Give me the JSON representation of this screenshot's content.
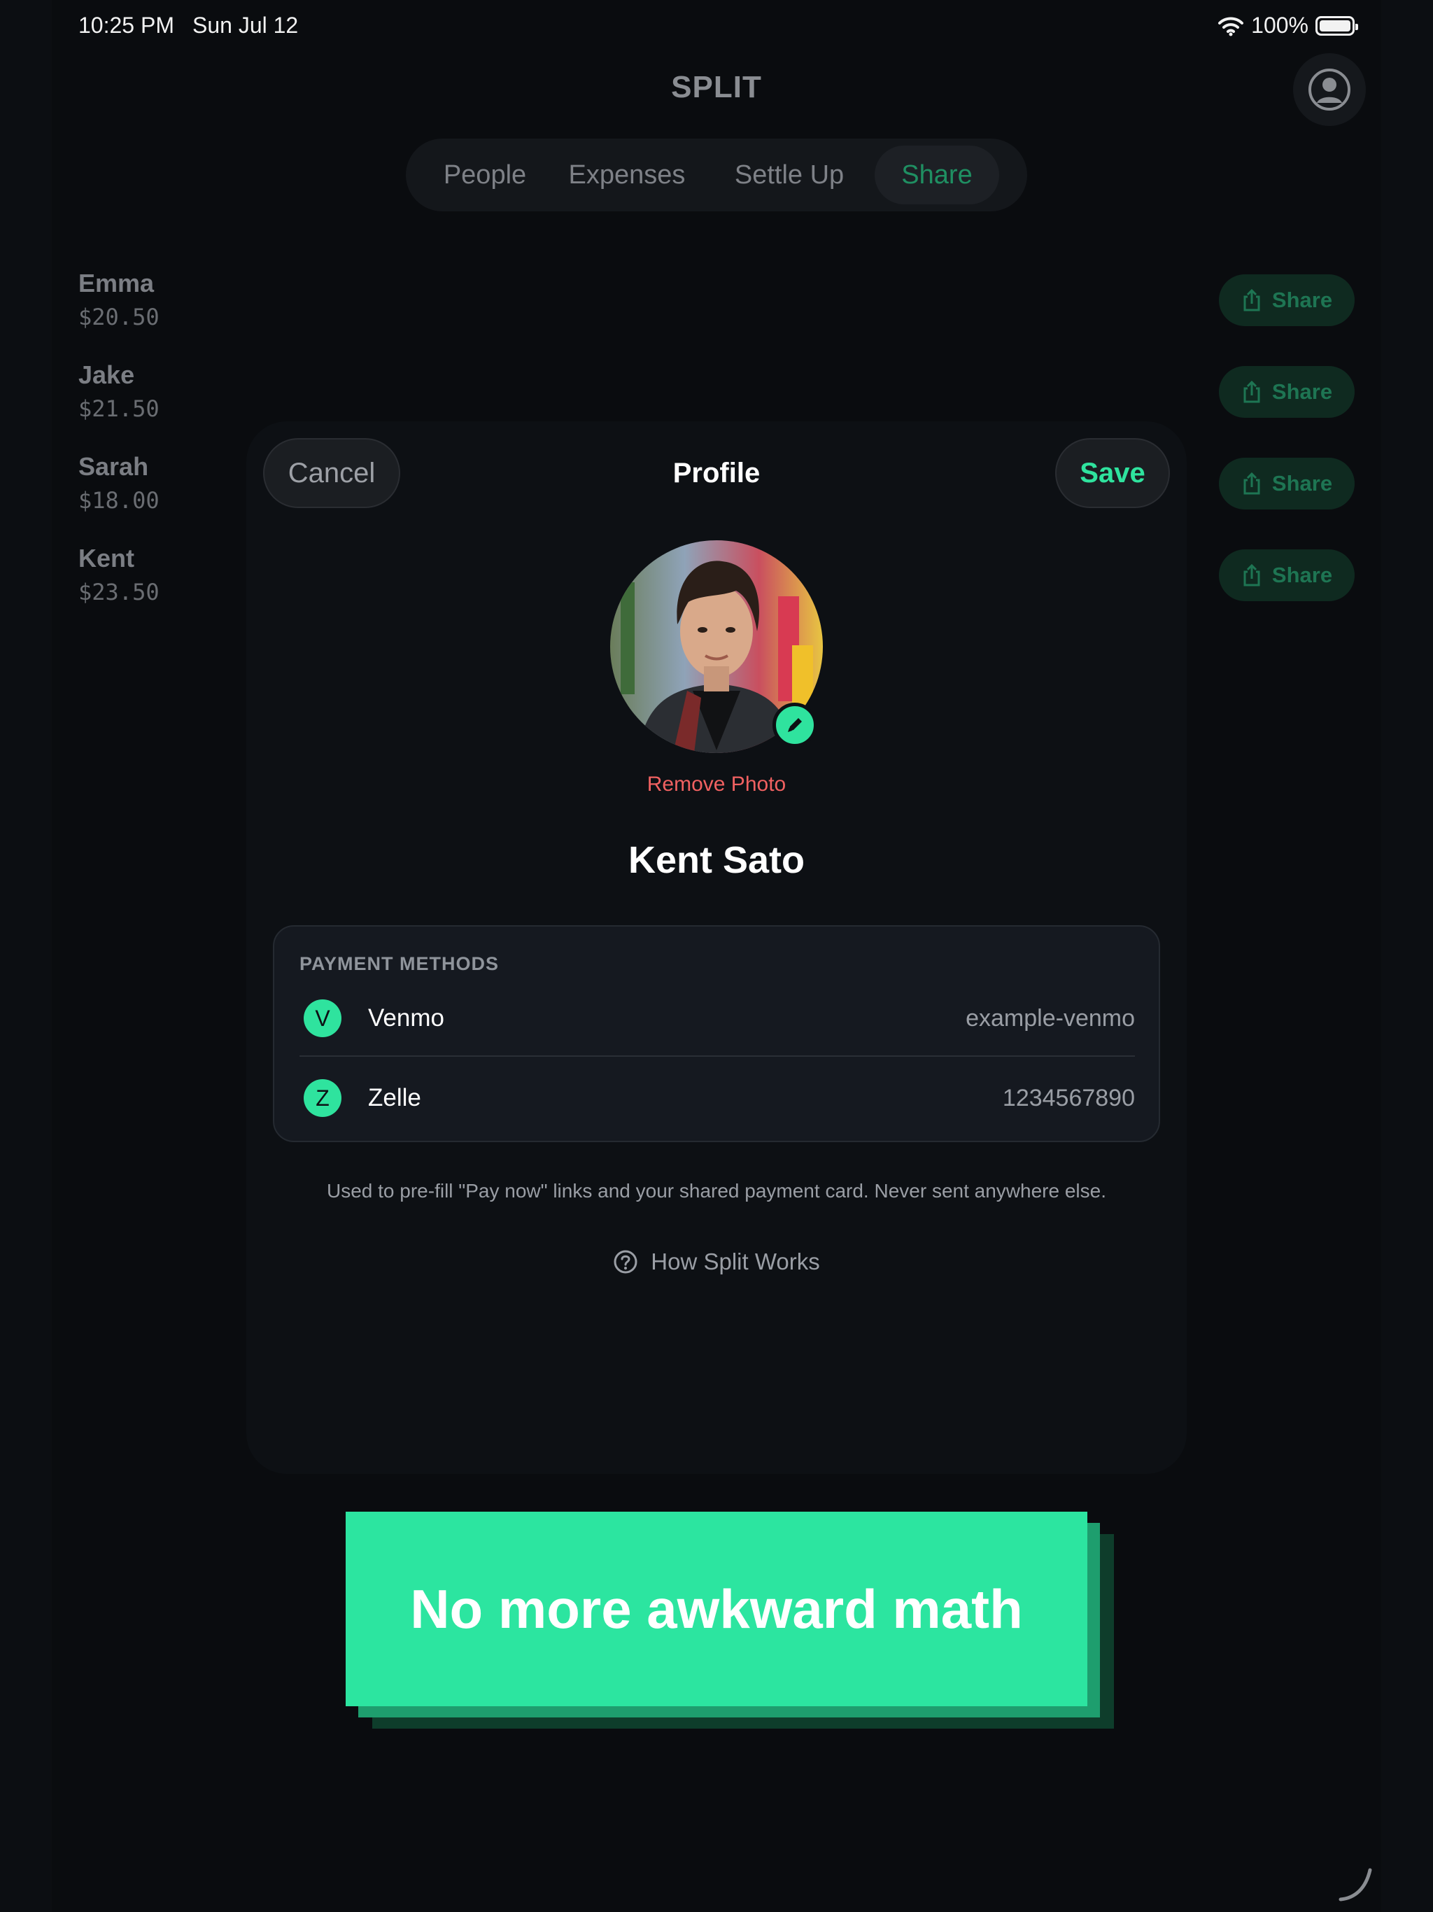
{
  "status_bar": {
    "time": "10:25 PM",
    "date": "Sun Jul 12",
    "battery": "100%"
  },
  "header": {
    "title": "SPLIT",
    "profile_icon": "person-circle-icon"
  },
  "tabs": [
    {
      "label": "People"
    },
    {
      "label": "Expenses"
    },
    {
      "label": "Settle Up"
    },
    {
      "label": "Share",
      "active": true
    }
  ],
  "people": [
    {
      "name": "Emma",
      "amount": "$20.50",
      "share_label": "Share"
    },
    {
      "name": "Jake",
      "amount": "$21.50",
      "share_label": "Share"
    },
    {
      "name": "Sarah",
      "amount": "$18.00",
      "share_label": "Share"
    },
    {
      "name": "Kent",
      "amount": "$23.50",
      "share_label": "Share"
    }
  ],
  "modal": {
    "title": "Profile",
    "cancel_label": "Cancel",
    "save_label": "Save",
    "remove_photo_label": "Remove Photo",
    "profile_name": "Kent Sato",
    "payment_methods": {
      "heading": "PAYMENT METHODS",
      "items": [
        {
          "letter": "V",
          "name": "Venmo",
          "value": "example-venmo"
        },
        {
          "letter": "Z",
          "name": "Zelle",
          "value": "1234567890"
        }
      ]
    },
    "footnote": "Used to pre-fill \"Pay now\" links and your shared payment card. Never sent anywhere else.",
    "how_label": "How Split Works"
  },
  "banner": {
    "text": "No more awkward math"
  },
  "colors": {
    "accent": "#2fe39e",
    "danger": "#f06161",
    "background": "#0a0c0f"
  }
}
